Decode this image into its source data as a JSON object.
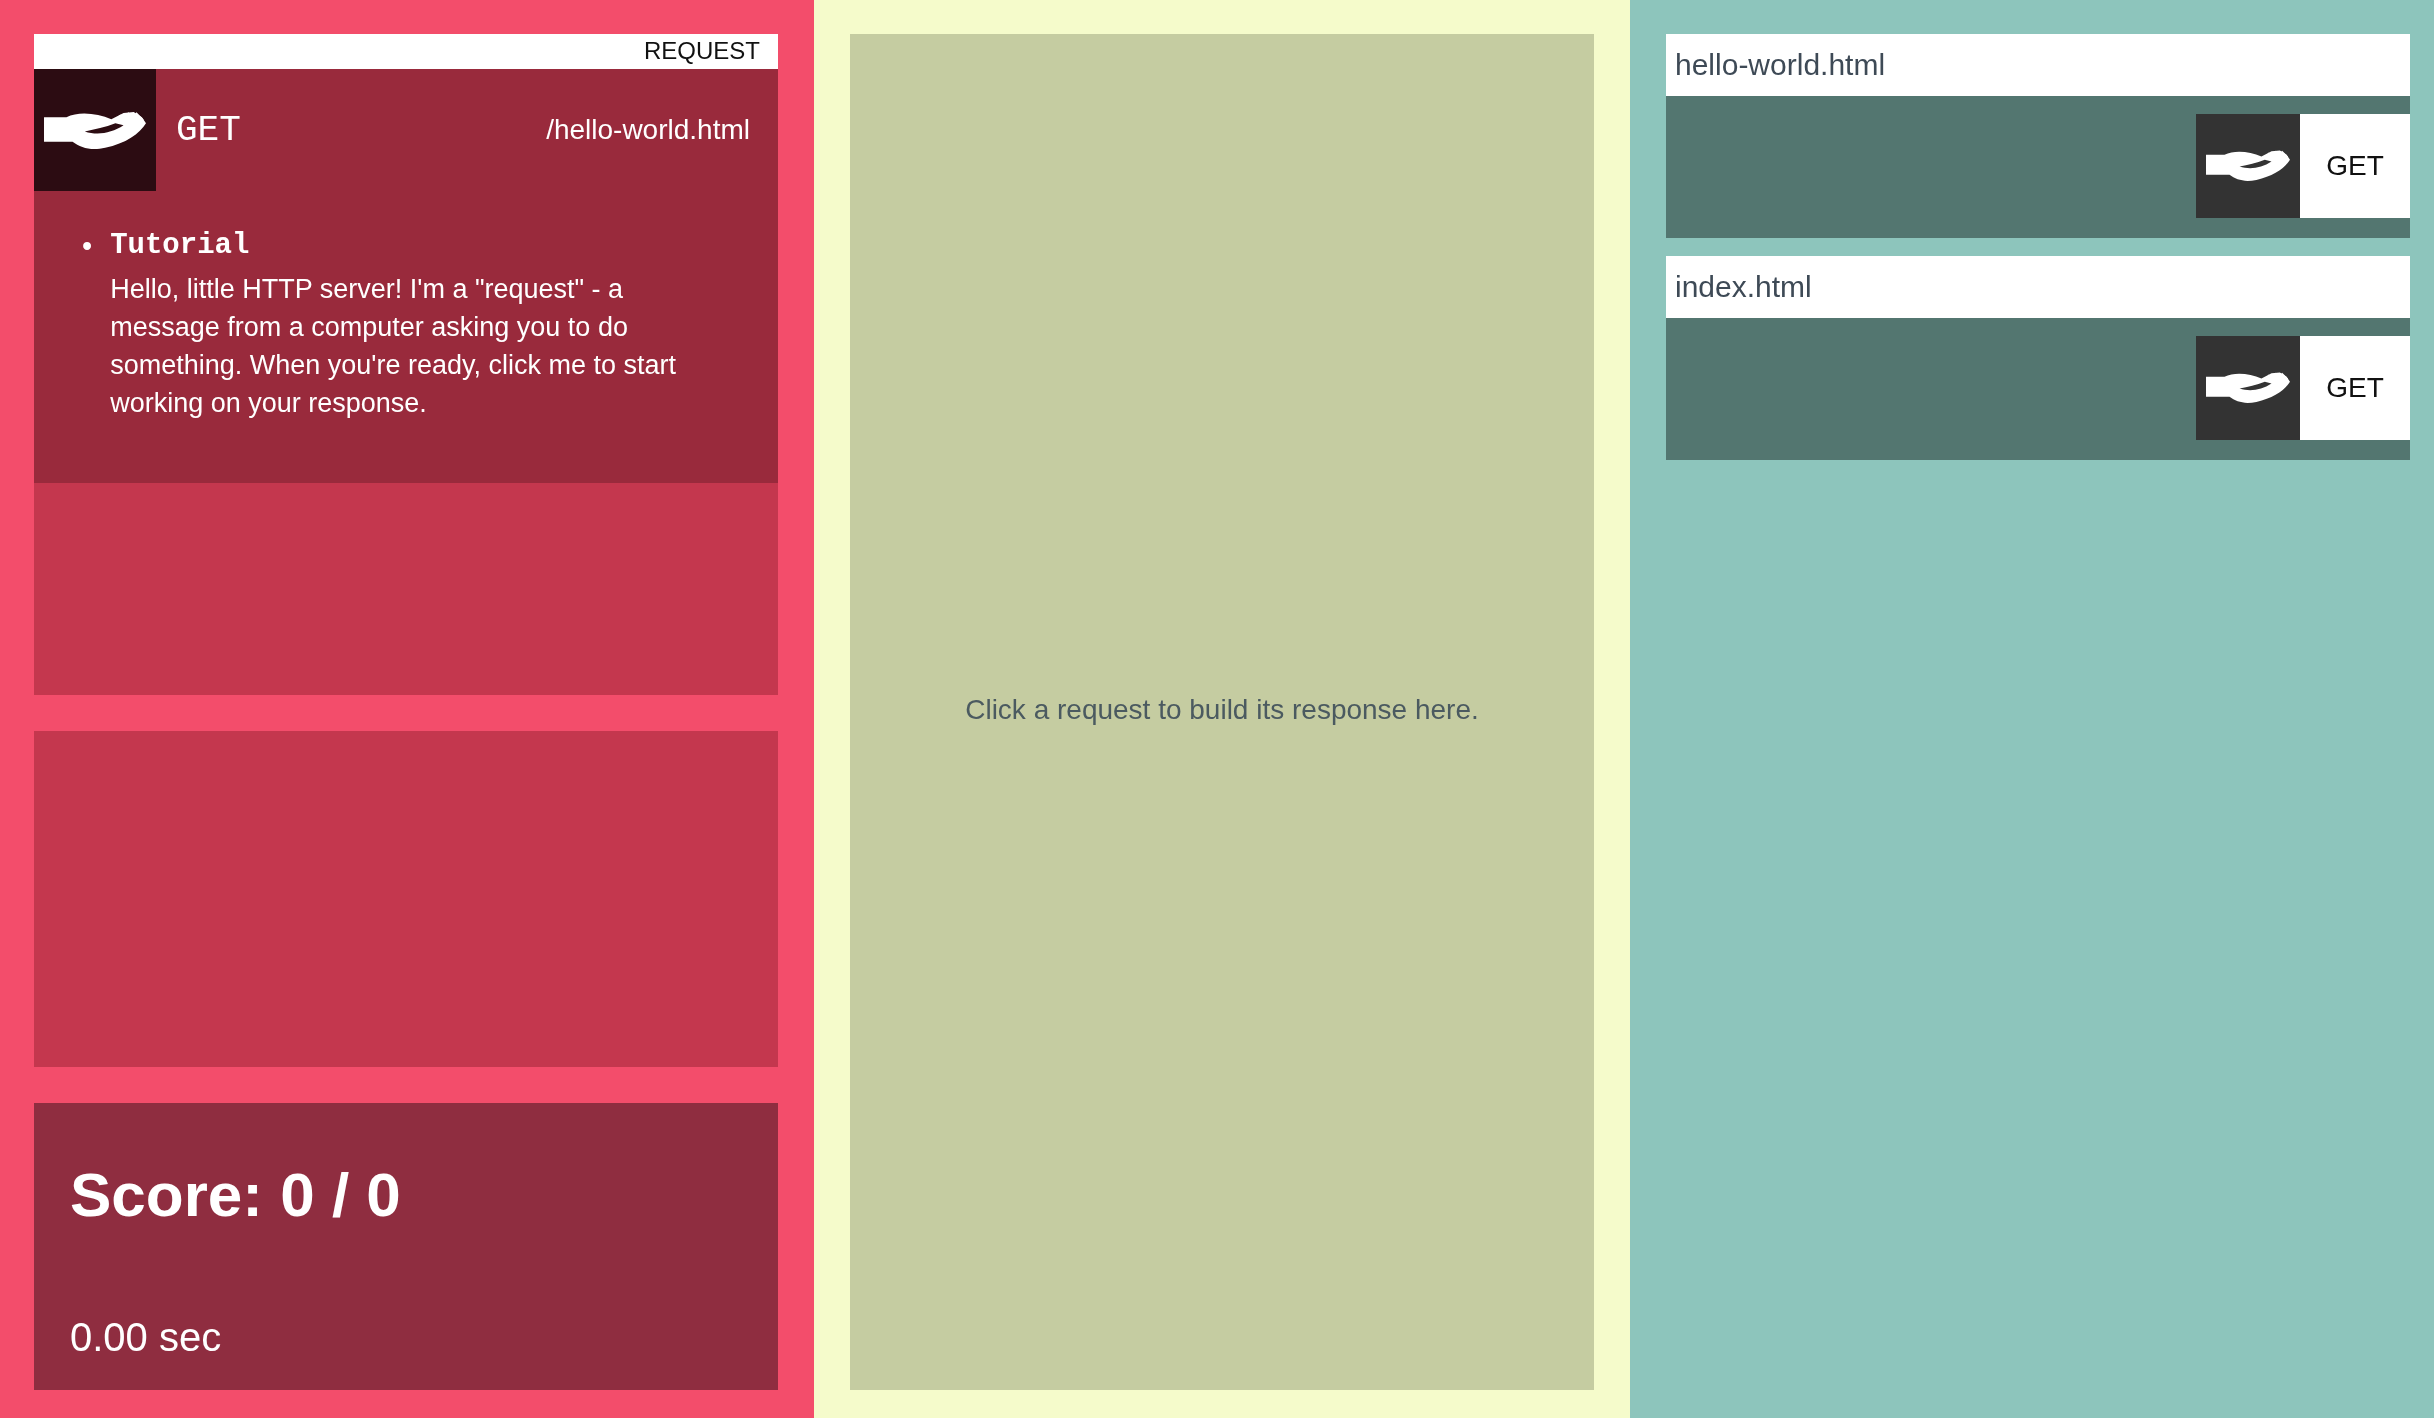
{
  "request_panel": {
    "label": "REQUEST",
    "method": "GET",
    "path": "/hello-world.html",
    "notes": [
      {
        "marker": "•",
        "title": "Tutorial",
        "text": "Hello, little HTTP server! I'm a \"request\" - a message from a computer asking you to do something. When you're ready, click me to start working on your response."
      }
    ]
  },
  "score": {
    "title": "Score: 0 / 0",
    "time": "0.00 sec"
  },
  "response_panel": {
    "hint": "Click a request to build its response here."
  },
  "files": [
    {
      "name": "hello-world.html",
      "method": "GET"
    },
    {
      "name": "index.html",
      "method": "GET"
    }
  ]
}
